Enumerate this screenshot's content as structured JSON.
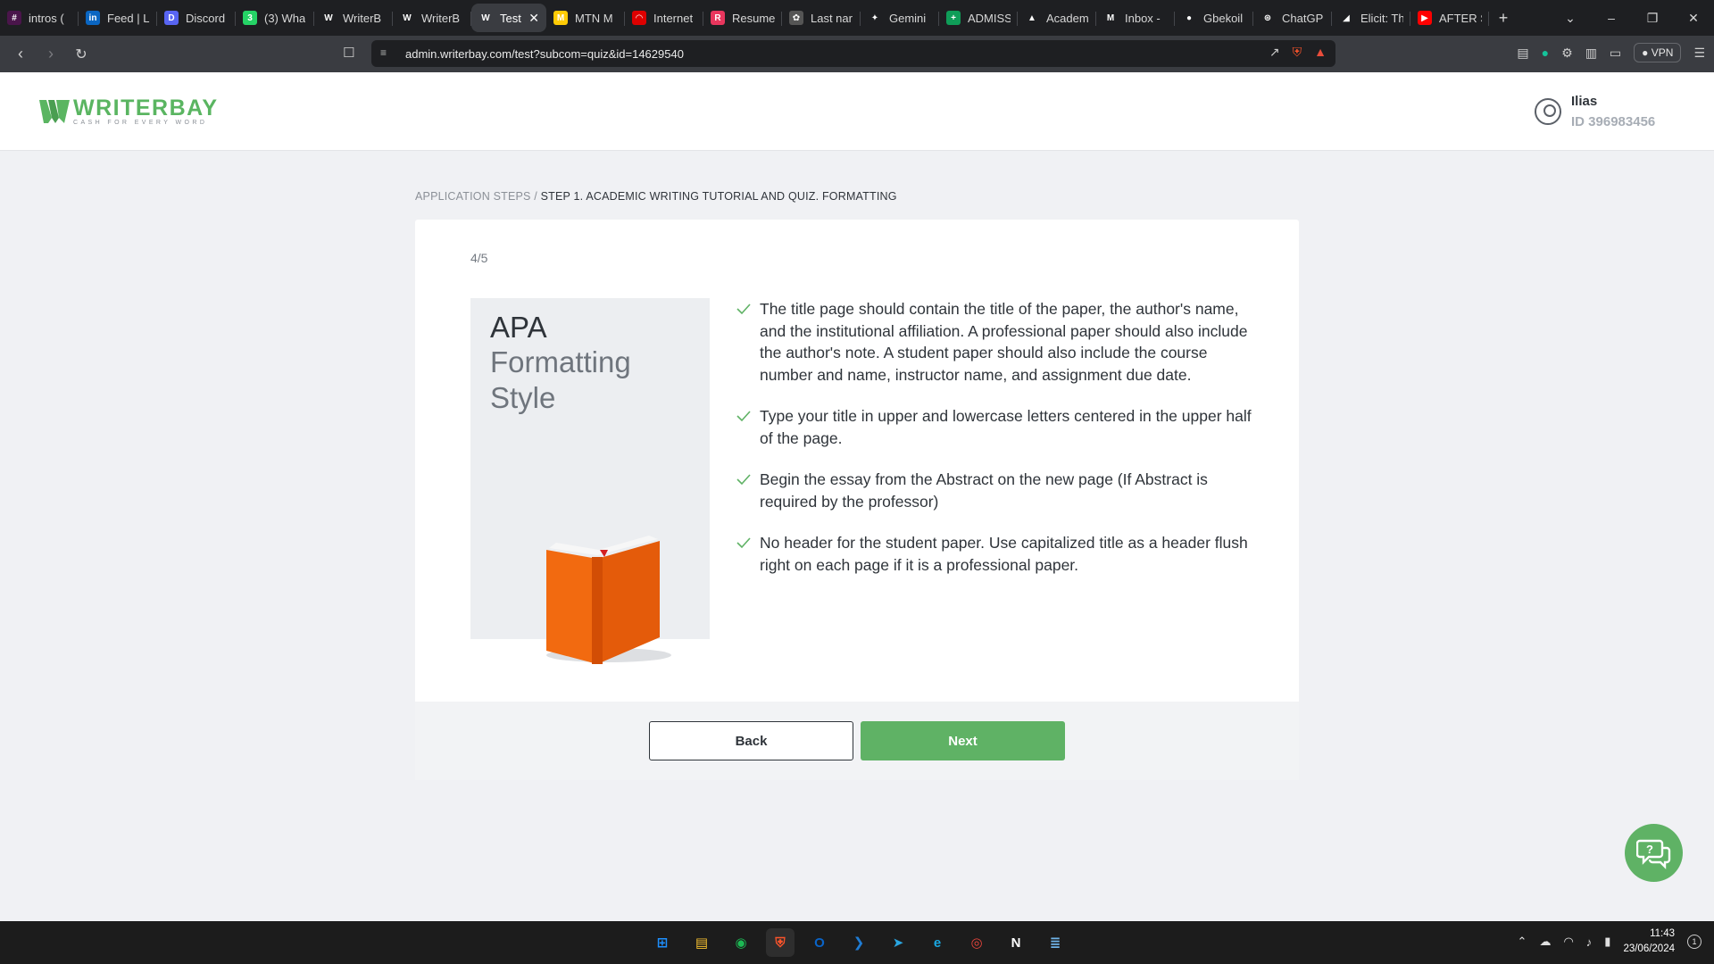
{
  "browser": {
    "tabs": [
      {
        "title": "intros (",
        "fav_color": "#4a154b",
        "fav_glyph": "#"
      },
      {
        "title": "Feed | Li",
        "fav_color": "#0a66c2",
        "fav_glyph": "in"
      },
      {
        "title": "Discord",
        "fav_color": "#5865f2",
        "fav_glyph": "D"
      },
      {
        "title": "(3) Wha",
        "fav_color": "#25d366",
        "fav_glyph": "3"
      },
      {
        "title": "WriterB",
        "fav_color": "#1e1f22",
        "fav_glyph": "W"
      },
      {
        "title": "WriterB",
        "fav_color": "#1e1f22",
        "fav_glyph": "W"
      },
      {
        "title": "Test",
        "fav_color": "#3a3c41",
        "fav_glyph": "W",
        "active": true
      },
      {
        "title": "MTN M",
        "fav_color": "#ffcb05",
        "fav_glyph": "M"
      },
      {
        "title": "Internet",
        "fav_color": "#d00",
        "fav_glyph": "◠"
      },
      {
        "title": "Resume",
        "fav_color": "#e8365d",
        "fav_glyph": "R"
      },
      {
        "title": "Last nar",
        "fav_color": "#555",
        "fav_glyph": "✿"
      },
      {
        "title": "Gemini",
        "fav_color": "#1e1f22",
        "fav_glyph": "✦"
      },
      {
        "title": "ADMISS",
        "fav_color": "#0f9d58",
        "fav_glyph": "+"
      },
      {
        "title": "Academ",
        "fav_color": "#1e1f22",
        "fav_glyph": "▲"
      },
      {
        "title": "Inbox -",
        "fav_color": "#1e1f22",
        "fav_glyph": "M"
      },
      {
        "title": "Gbekoil",
        "fav_color": "#1e1f22",
        "fav_glyph": "●"
      },
      {
        "title": "ChatGP",
        "fav_color": "#1e1f22",
        "fav_glyph": "⊛"
      },
      {
        "title": "Elicit: Th",
        "fav_color": "#1e1f22",
        "fav_glyph": "◢"
      },
      {
        "title": "AFTER S",
        "fav_color": "#ff0000",
        "fav_glyph": "▶"
      }
    ],
    "url": "admin.writerbay.com/test?subcom=quiz&id=14629540",
    "vpn_label": "VPN"
  },
  "site": {
    "brand": "WRITERBAY",
    "tagline": "CASH FOR EVERY WORD",
    "user_name": "Ilias",
    "user_id": "ID 396983456",
    "accent": "#5fb265"
  },
  "breadcrumb": {
    "root": "APPLICATION STEPS",
    "separator": " / ",
    "current": "STEP 1. ACADEMIC WRITING TUTORIAL AND QUIZ. FORMATTING"
  },
  "quiz": {
    "counter": "4/5",
    "illustration": {
      "line1": "APA",
      "line2": "Formatting Style"
    },
    "items": [
      "The title page should contain the title of the paper, the author's name, and the institutional affiliation. A professional paper should also include the author's note. A student paper should also include the course number and name, instructor name, and assignment due date.",
      "Type your title in upper and lowercase letters centered in the upper half of the page.",
      "Begin the essay from the Abstract on the new page (If Abstract is required by the professor)",
      "No header for the student paper. Use capitalized title as a header flush right on each page if it is a professional paper."
    ],
    "back_label": "Back",
    "next_label": "Next"
  },
  "taskbar": {
    "apps": [
      "start-menu",
      "file-explorer",
      "spotify",
      "brave-browser",
      "outlook",
      "vscode",
      "telegram",
      "edge",
      "chrome",
      "notion",
      "notepad"
    ],
    "time": "11:43",
    "date": "23/06/2024",
    "notification_count": "1"
  }
}
